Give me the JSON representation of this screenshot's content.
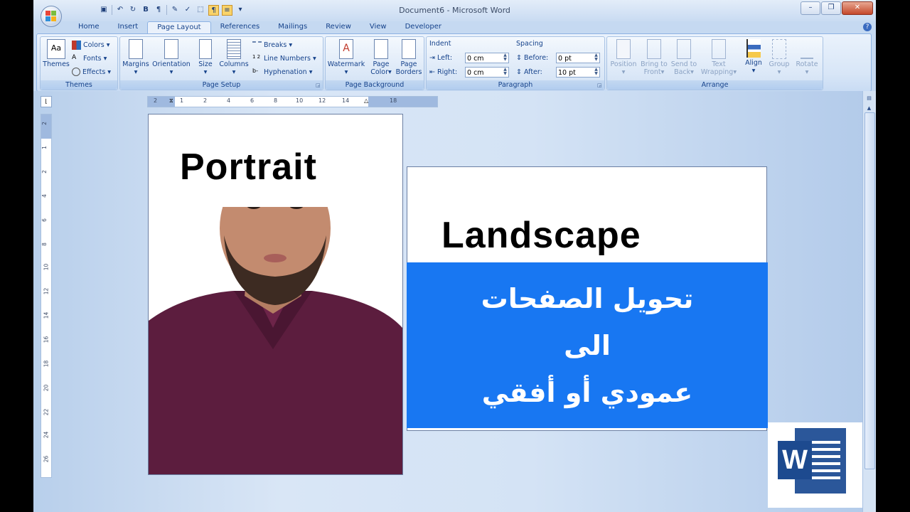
{
  "window": {
    "title": "Document6 - Microsoft Word"
  },
  "tabs": [
    "Home",
    "Insert",
    "Page Layout",
    "References",
    "Mailings",
    "Review",
    "View",
    "Developer"
  ],
  "active_tab": "Page Layout",
  "ribbon": {
    "themes": {
      "big_label": "Themes",
      "colors": "Colors",
      "fonts": "Fonts",
      "effects": "Effects",
      "group": "Themes"
    },
    "page_setup": {
      "margins": "Margins",
      "orientation": "Orientation",
      "size": "Size",
      "columns": "Columns",
      "breaks": "Breaks",
      "line_numbers": "Line Numbers",
      "hyphenation": "Hyphenation",
      "group": "Page Setup"
    },
    "page_background": {
      "watermark": "Watermark",
      "page_color_1": "Page",
      "page_color_2": "Color",
      "page_borders_1": "Page",
      "page_borders_2": "Borders",
      "group": "Page Background"
    },
    "paragraph": {
      "indent": "Indent",
      "left_label": "Left:",
      "left_value": "0 cm",
      "right_label": "Right:",
      "right_value": "0 cm",
      "spacing": "Spacing",
      "before_label": "Before:",
      "before_value": "0 pt",
      "after_label": "After:",
      "after_value": "10 pt",
      "group": "Paragraph"
    },
    "arrange": {
      "position": "Position",
      "bring_1": "Bring to",
      "bring_2": "Front",
      "send_1": "Send to",
      "send_2": "Back",
      "wrap_1": "Text",
      "wrap_2": "Wrapping",
      "align": "Align",
      "group_btn": "Group",
      "rotate": "Rotate",
      "group": "Arrange"
    }
  },
  "ruler": {
    "h_numbers": [
      "2",
      "1",
      "2",
      "4",
      "6",
      "8",
      "10",
      "12",
      "14",
      "16",
      "18"
    ],
    "v_numbers": [
      "2",
      "1",
      "2",
      "4",
      "6",
      "8",
      "10",
      "12",
      "14",
      "16",
      "18",
      "20",
      "22",
      "24",
      "26"
    ]
  },
  "document": {
    "portrait_text": "Portrait",
    "landscape_text": "Landscape",
    "arabic_line1": "تحويل الصفحات",
    "arabic_line2": "الى",
    "arabic_line3": "عمودي أو أفقي"
  },
  "logo": {
    "letter": "W"
  },
  "colors": {
    "accent_blue": "#1877f2",
    "word_blue": "#2b579a"
  }
}
